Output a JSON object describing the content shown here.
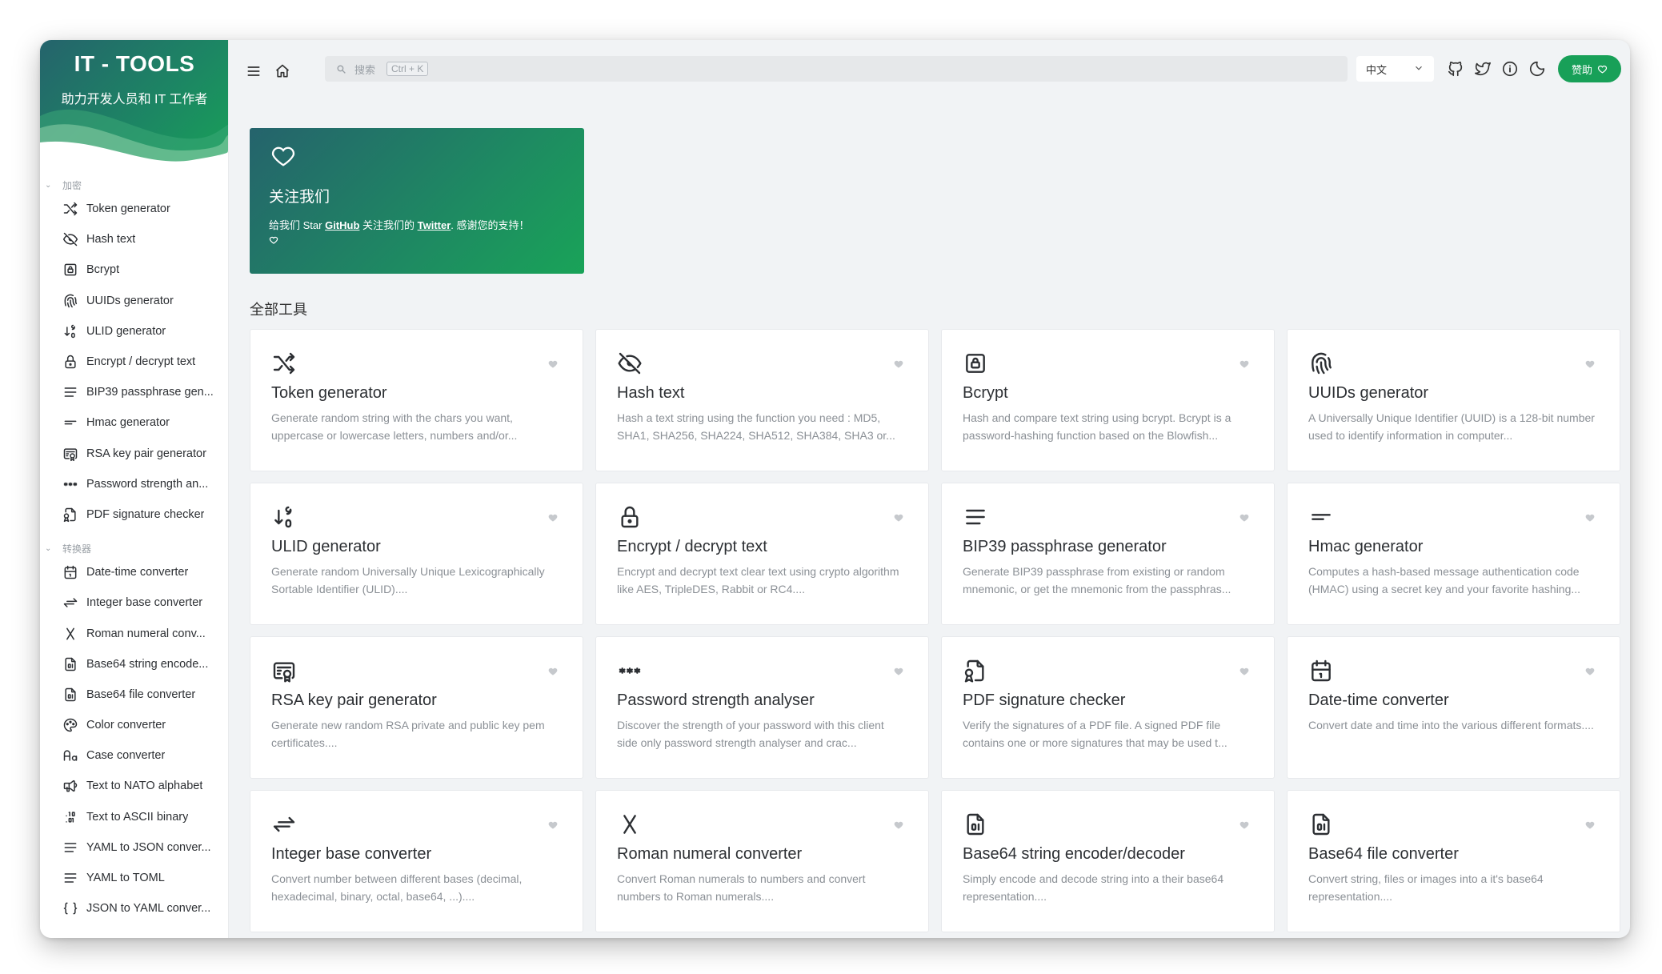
{
  "brand": {
    "title": "IT - TOOLS",
    "subtitle": "助力开发人员和 IT 工作者"
  },
  "sidebar": {
    "groups": [
      {
        "label": "加密",
        "items": [
          {
            "label": "Token generator",
            "icon": "shuffle-icon"
          },
          {
            "label": "Hash text",
            "icon": "eye-off-icon"
          },
          {
            "label": "Bcrypt",
            "icon": "lock-square-icon"
          },
          {
            "label": "UUIDs generator",
            "icon": "fingerprint-icon"
          },
          {
            "label": "ULID generator",
            "icon": "sort-numeric-icon"
          },
          {
            "label": "Encrypt / decrypt text",
            "icon": "lock-icon"
          },
          {
            "label": "BIP39 passphrase gen...",
            "icon": "lines-icon"
          },
          {
            "label": "Hmac generator",
            "icon": "short-lines-icon"
          },
          {
            "label": "RSA key pair generator",
            "icon": "certificate-icon"
          },
          {
            "label": "Password strength an...",
            "icon": "password-icon"
          },
          {
            "label": "PDF signature checker",
            "icon": "file-certificate-icon"
          }
        ]
      },
      {
        "label": "转换器",
        "items": [
          {
            "label": "Date-time converter",
            "icon": "calendar-icon"
          },
          {
            "label": "Integer base converter",
            "icon": "arrows-exchange-icon"
          },
          {
            "label": "Roman numeral conv...",
            "icon": "letter-x-icon"
          },
          {
            "label": "Base64 string encode...",
            "icon": "file-digit-icon"
          },
          {
            "label": "Base64 file converter",
            "icon": "file-digit-icon"
          },
          {
            "label": "Color converter",
            "icon": "palette-icon"
          },
          {
            "label": "Case converter",
            "icon": "letter-case-icon"
          },
          {
            "label": "Text to NATO alphabet",
            "icon": "speakerphone-icon"
          },
          {
            "label": "Text to ASCII binary",
            "icon": "binary-icon"
          },
          {
            "label": "YAML to JSON conver...",
            "icon": "lines-icon"
          },
          {
            "label": "YAML to TOML",
            "icon": "lines-icon"
          },
          {
            "label": "JSON to YAML conver...",
            "icon": "braces-icon"
          }
        ]
      }
    ]
  },
  "header": {
    "search_placeholder": "搜索",
    "search_shortcut": "Ctrl + K",
    "language": "中文",
    "sponsor_label": "赞助"
  },
  "follow": {
    "title": "关注我们",
    "text_1": "给我们 Star ",
    "github": "GitHub",
    "text_2": " 关注我们的 ",
    "twitter": "Twitter",
    "text_3": ". 感谢您的支持！"
  },
  "section_title": "全部工具",
  "tools": [
    {
      "title": "Token generator",
      "desc": "Generate random string with the chars you want, uppercase or lowercase letters, numbers and/or...",
      "icon": "shuffle-icon"
    },
    {
      "title": "Hash text",
      "desc": "Hash a text string using the function you need : MD5, SHA1, SHA256, SHA224, SHA512, SHA384, SHA3 or...",
      "icon": "eye-off-icon"
    },
    {
      "title": "Bcrypt",
      "desc": "Hash and compare text string using bcrypt. Bcrypt is a password-hashing function based on the Blowfish...",
      "icon": "lock-square-icon"
    },
    {
      "title": "UUIDs generator",
      "desc": "A Universally Unique Identifier (UUID) is a 128-bit number used to identify information in computer...",
      "icon": "fingerprint-icon"
    },
    {
      "title": "ULID generator",
      "desc": "Generate random Universally Unique Lexicographically Sortable Identifier (ULID)....",
      "icon": "sort-numeric-icon"
    },
    {
      "title": "Encrypt / decrypt text",
      "desc": "Encrypt and decrypt text clear text using crypto algorithm like AES, TripleDES, Rabbit or RC4....",
      "icon": "lock-icon"
    },
    {
      "title": "BIP39 passphrase generator",
      "desc": "Generate BIP39 passphrase from existing or random mnemonic, or get the mnemonic from the passphras...",
      "icon": "lines-icon"
    },
    {
      "title": "Hmac generator",
      "desc": "Computes a hash-based message authentication code (HMAC) using a secret key and your favorite hashing...",
      "icon": "short-lines-icon"
    },
    {
      "title": "RSA key pair generator",
      "desc": "Generate new random RSA private and public key pem certificates....",
      "icon": "certificate-icon"
    },
    {
      "title": "Password strength analyser",
      "desc": "Discover the strength of your password with this client side only password strength analyser and crac...",
      "icon": "password-icon"
    },
    {
      "title": "PDF signature checker",
      "desc": "Verify the signatures of a PDF file. A signed PDF file contains one or more signatures that may be used t...",
      "icon": "file-certificate-icon"
    },
    {
      "title": "Date-time converter",
      "desc": "Convert date and time into the various different formats....",
      "icon": "calendar-icon"
    },
    {
      "title": "Integer base converter",
      "desc": "Convert number between different bases (decimal, hexadecimal, binary, octal, base64, ...)....",
      "icon": "arrows-exchange-icon"
    },
    {
      "title": "Roman numeral converter",
      "desc": "Convert Roman numerals to numbers and convert numbers to Roman numerals....",
      "icon": "letter-x-icon"
    },
    {
      "title": "Base64 string encoder/decoder",
      "desc": "Simply encode and decode string into a their base64 representation....",
      "icon": "file-digit-icon"
    },
    {
      "title": "Base64 file converter",
      "desc": "Convert string, files or images into a it's base64 representation....",
      "icon": "file-digit-icon"
    }
  ],
  "colors": {
    "accent": "#18a058",
    "brand_dark": "#25636c"
  }
}
